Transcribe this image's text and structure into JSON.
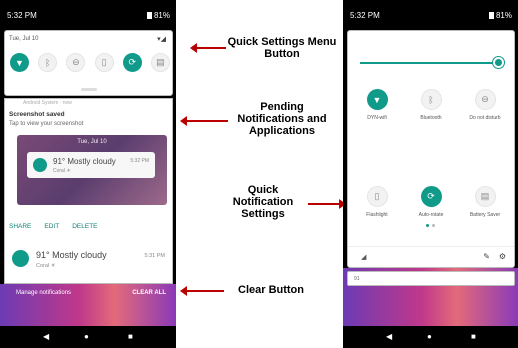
{
  "left_phone": {
    "status": {
      "time": "5:32 PM",
      "battery": "81%"
    },
    "quick_settings": {
      "date": "Tue, Jul 10",
      "signal_icons": "▾◢",
      "tiles": [
        {
          "name": "wifi",
          "state": "on"
        },
        {
          "name": "bluetooth",
          "state": "off"
        },
        {
          "name": "do-not-disturb",
          "state": "off"
        },
        {
          "name": "flashlight",
          "state": "off"
        },
        {
          "name": "auto-rotate",
          "state": "on"
        },
        {
          "name": "battery-saver",
          "state": "off"
        }
      ]
    },
    "notifications": {
      "top_snippet": "Android System · now",
      "screenshot": {
        "title": "Screenshot saved",
        "subtitle": "Tap to view your screenshot",
        "preview_date": "Tue, Jul 10",
        "preview_weather": "91° Mostly cloudy",
        "preview_time": "5:32 PM",
        "preview_sub": "Coral ☀",
        "actions": [
          "SHARE",
          "EDIT",
          "DELETE"
        ]
      },
      "weather": {
        "title": "91° Mostly cloudy",
        "subtitle": "Coral ☀",
        "time": "5:31 PM"
      }
    },
    "footer": {
      "manage": "Manage notifications",
      "clear_all": "CLEAR ALL"
    },
    "navbar": {
      "back": "◀",
      "home": "●",
      "recents": "■"
    }
  },
  "annotations": {
    "quick_settings_button": "Quick Settings Menu Button",
    "pending": "Pending Notifications and Applications",
    "quick_notification": "Quick Notification Settings",
    "clear_button": "Clear Button"
  },
  "right_phone": {
    "status": {
      "time": "5:32 PM",
      "battery": "81%"
    },
    "expanded_tiles": [
      {
        "name": "wifi",
        "label": "DYN-wifi",
        "state": "on"
      },
      {
        "name": "bluetooth",
        "label": "Bluetooth",
        "state": "off"
      },
      {
        "name": "do-not-disturb",
        "label": "Do not disturb",
        "state": "off"
      },
      {
        "name": "flashlight",
        "label": "Flashlight",
        "state": "off"
      },
      {
        "name": "auto-rotate",
        "label": "Auto-rotate",
        "state": "on"
      },
      {
        "name": "battery-saver",
        "label": "Battery Saver",
        "state": "off"
      }
    ],
    "bottom": {
      "signal": "◢",
      "edit": "✎",
      "settings": "⚙"
    },
    "mini_text": "91"
  },
  "colors": {
    "accent": "#0f9a8a",
    "arrow": "#bb0000",
    "panel_border": "#bbbbbb"
  }
}
